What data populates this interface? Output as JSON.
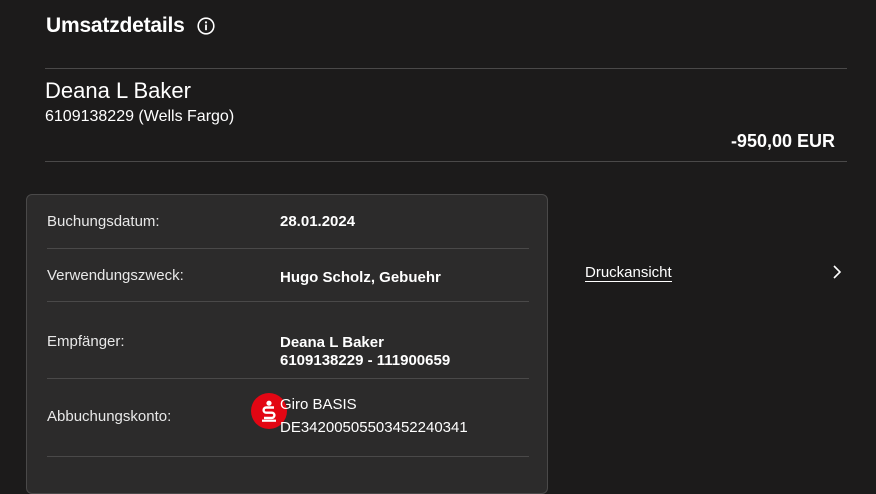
{
  "header": {
    "title": "Umsatzdetails",
    "info_icon": "info-icon"
  },
  "counterparty": {
    "name": "Deana L Baker",
    "account": "6109138229 (Wells Fargo)"
  },
  "amount": "-950,00 EUR",
  "details": {
    "booking_date": {
      "label": "Buchungsdatum:",
      "value": "28.01.2024"
    },
    "purpose": {
      "label": "Verwendungszweck:",
      "value": "Hugo Scholz, Gebuehr"
    },
    "recipient": {
      "label": "Empfänger:",
      "name": "Deana L Baker",
      "account": "6109138229 - 111900659"
    },
    "debit_account": {
      "label": "Abbuchungskonto:",
      "product": "Giro BASIS",
      "iban": "DE34200505503452240341",
      "icon": "sparkasse-logo-icon"
    }
  },
  "actions": {
    "print_label": "Druckansicht",
    "chevron_icon": "chevron-right-icon"
  },
  "colors": {
    "background": "#1c1b1b",
    "card": "#2c2b2b",
    "divider": "#4a4949",
    "brand_red": "#e30613"
  }
}
